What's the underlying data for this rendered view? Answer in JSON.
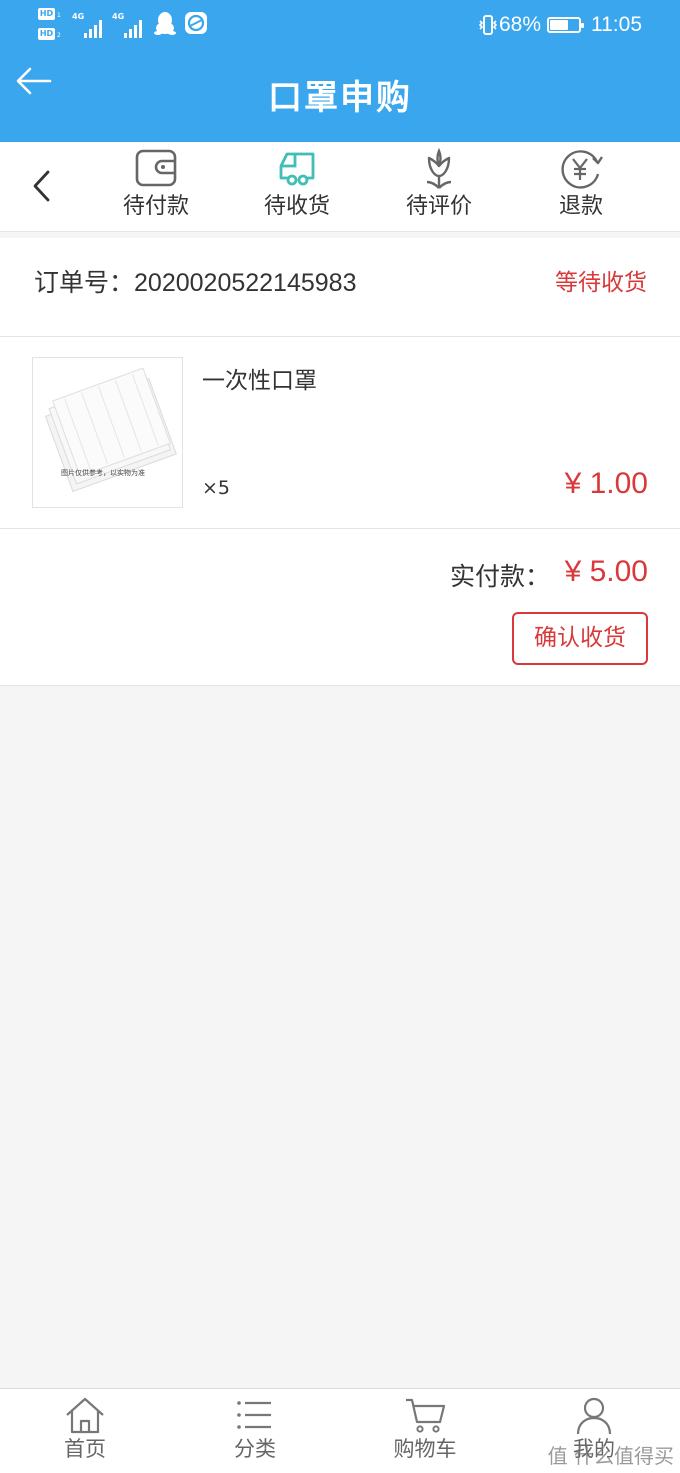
{
  "status_bar": {
    "hd1": "HD",
    "hd1_sub": "1",
    "hd2": "HD",
    "hd2_sub": "2",
    "net1": "4G",
    "net2": "4G",
    "battery_text": "68%",
    "battery_level": 0.68,
    "time": "11:05"
  },
  "header": {
    "title": "口罩申购"
  },
  "tabs": [
    {
      "label": "待付款",
      "icon": "wallet-icon"
    },
    {
      "label": "待收货",
      "icon": "delivery-truck-icon",
      "active": true
    },
    {
      "label": "待评价",
      "icon": "flower-icon"
    },
    {
      "label": "退款",
      "icon": "refund-yen-icon"
    }
  ],
  "order": {
    "order_no_label": "订单号：",
    "order_no": "2020020522145983",
    "status": "等待收货",
    "item": {
      "name": "一次性口罩",
      "thumb_caption": "图片仅供参考，以实物为准",
      "qty": "×5",
      "price": "¥ 1.00"
    },
    "paid_label": "实付款：",
    "paid_amount": "¥ 5.00",
    "confirm_label": "确认收货"
  },
  "bottom_nav": [
    {
      "label": "首页",
      "icon": "home-icon"
    },
    {
      "label": "分类",
      "icon": "list-icon"
    },
    {
      "label": "购物车",
      "icon": "cart-icon"
    },
    {
      "label": "我的",
      "icon": "user-icon"
    }
  ],
  "watermark": "值 什么值得买",
  "colors": {
    "header_blue": "#3aa6ee",
    "accent_red": "#d9393a",
    "active_tab_teal": "#3fbfb5"
  }
}
